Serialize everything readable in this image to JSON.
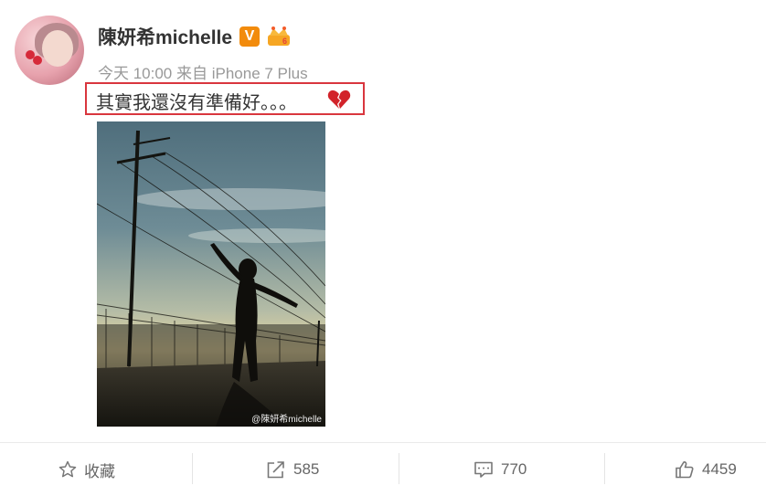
{
  "post": {
    "username": "陳妍希michelle",
    "verified_badge": "V",
    "meta": "今天 10:00 来自 iPhone 7 Plus",
    "text": "其實我還沒有準備好。。。",
    "photo_credit": "@陳妍希michelle",
    "accent_color": "#d9363e"
  },
  "actions": {
    "favorite_label": "收藏",
    "share_count": "585",
    "comment_count": "770",
    "like_count": "4459"
  },
  "icons": [
    "star-icon",
    "share-icon",
    "comment-icon",
    "thumbs-up-icon",
    "broken-heart-icon",
    "crown-badge-icon"
  ]
}
